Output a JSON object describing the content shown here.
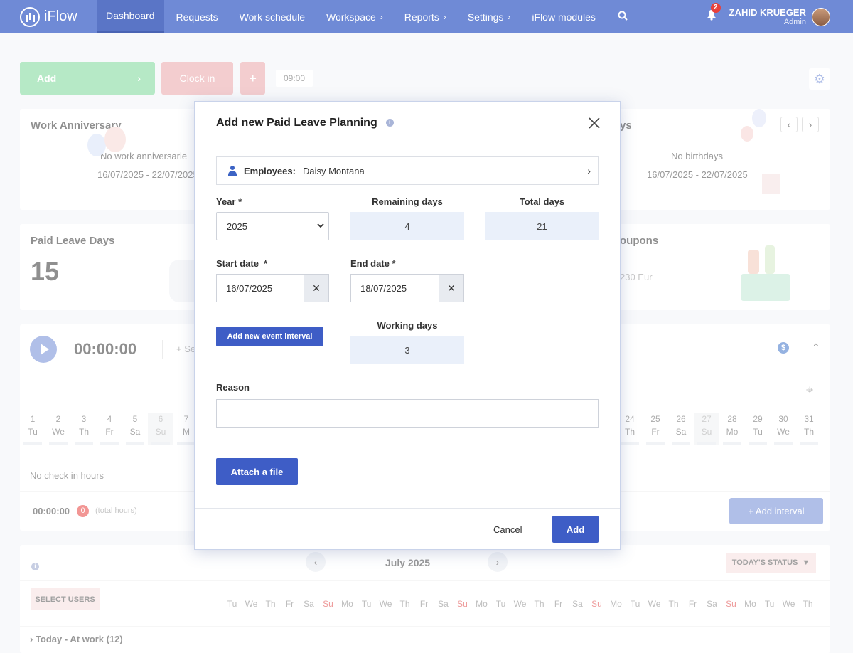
{
  "nav": {
    "brand": "iFlow",
    "items": [
      {
        "label": "Dashboard",
        "active": true,
        "caret": false
      },
      {
        "label": "Requests",
        "active": false,
        "caret": false
      },
      {
        "label": "Work schedule",
        "active": false,
        "caret": false
      },
      {
        "label": "Workspace",
        "active": false,
        "caret": true
      },
      {
        "label": "Reports",
        "active": false,
        "caret": true
      },
      {
        "label": "Settings",
        "active": false,
        "caret": true
      },
      {
        "label": "iFlow modules",
        "active": false,
        "caret": false
      }
    ],
    "notifications": "2",
    "user_name": "ZAHID KRUEGER",
    "user_role": "Admin"
  },
  "toolbar": {
    "add_label": "Add",
    "clock_in_label": "Clock in",
    "time": "09:00"
  },
  "cards": {
    "anniversary_title": "Work Anniversary",
    "anniversary_text": "No work anniversarie",
    "anniversary_range": "16/07/2025 - 22/07/2025",
    "birthdays_title_partial": "ys",
    "birthdays_text": "No birthdays",
    "birthdays_range": "16/07/2025 - 22/07/2025",
    "paid_leave_title": "Paid Leave Days",
    "paid_leave_value": "15",
    "coupons_title_partial": "oupons",
    "coupons_value_partial": "230 Eur"
  },
  "timer": {
    "value": "00:00:00",
    "partial": "+ Se",
    "no_checkin": "No check in hours",
    "total": "00:00:00",
    "total_badge": "0",
    "total_label": "(total hours)",
    "add_interval": "+ Add interval"
  },
  "calendar_left": [
    {
      "n": "1",
      "d": "Tu",
      "wk": false
    },
    {
      "n": "2",
      "d": "We",
      "wk": false
    },
    {
      "n": "3",
      "d": "Th",
      "wk": false
    },
    {
      "n": "4",
      "d": "Fr",
      "wk": false
    },
    {
      "n": "5",
      "d": "Sa",
      "wk": false
    },
    {
      "n": "6",
      "d": "Su",
      "wk": true
    },
    {
      "n": "7",
      "d": "M",
      "wk": false
    }
  ],
  "calendar_right": [
    {
      "n": "24",
      "d": "Th",
      "wk": false
    },
    {
      "n": "25",
      "d": "Fr",
      "wk": false
    },
    {
      "n": "26",
      "d": "Sa",
      "wk": false
    },
    {
      "n": "27",
      "d": "Su",
      "wk": true
    },
    {
      "n": "28",
      "d": "Mo",
      "wk": false
    },
    {
      "n": "29",
      "d": "Tu",
      "wk": false
    },
    {
      "n": "30",
      "d": "We",
      "wk": false
    },
    {
      "n": "31",
      "d": "Th",
      "wk": false
    }
  ],
  "bottom": {
    "month": "July 2025",
    "todays_status": "TODAY'S STATUS",
    "select_users": "SELECT USERS",
    "today_at_work": "Today - At work (12)",
    "week_days": [
      "Tu",
      "We",
      "Th",
      "Fr",
      "Sa",
      "Su",
      "Mo",
      "Tu",
      "We",
      "Th",
      "Fr",
      "Sa",
      "Su",
      "Mo",
      "Tu",
      "We",
      "Th",
      "Fr",
      "Sa",
      "Su",
      "Mo",
      "Tu",
      "We",
      "Th",
      "Fr",
      "Sa",
      "Su",
      "Mo",
      "Tu",
      "We",
      "Th"
    ]
  },
  "modal": {
    "title": "Add new Paid Leave Planning",
    "employees_label": "Employees:",
    "employees_value": "Daisy Montana",
    "year_label": "Year *",
    "year_value": "2025",
    "remaining_label": "Remaining days",
    "remaining_value": "4",
    "total_label": "Total days",
    "total_value": "21",
    "start_label": "Start date  *",
    "start_value": "16/07/2025",
    "end_label": "End date *",
    "end_value": "18/07/2025",
    "add_interval_label": "Add new event interval",
    "working_label": "Working days",
    "working_value": "3",
    "reason_label": "Reason",
    "reason_value": "",
    "attach_label": "Attach a file",
    "cancel_label": "Cancel",
    "add_label": "Add"
  }
}
